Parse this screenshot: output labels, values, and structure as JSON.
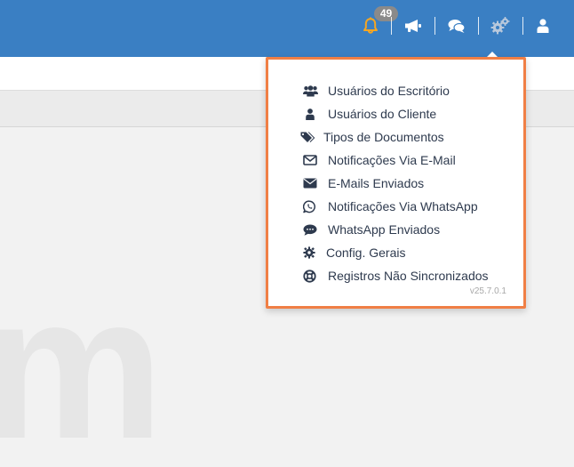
{
  "header": {
    "notifications_badge": "49",
    "icons": [
      "bell-icon",
      "megaphone-icon",
      "chat-icon",
      "gears-icon",
      "user-icon"
    ],
    "accent_color": "#3a7fc3",
    "bell_color": "#f5a623"
  },
  "dropdown": {
    "border_color": "#f07f45",
    "items": [
      {
        "label": "Usuários do Escritório",
        "icon": "users-icon"
      },
      {
        "label": "Usuários do Cliente",
        "icon": "user-icon"
      },
      {
        "label": "Tipos de Documentos",
        "icon": "tags-icon"
      },
      {
        "label": "Notificações Via E-Mail",
        "icon": "envelope-outline-icon"
      },
      {
        "label": "E-Mails Enviados",
        "icon": "envelope-icon"
      },
      {
        "label": "Notificações Via WhatsApp",
        "icon": "whatsapp-icon"
      },
      {
        "label": "WhatsApp Enviados",
        "icon": "speech-bubble-icon"
      },
      {
        "label": "Config. Gerais",
        "icon": "gear-icon"
      },
      {
        "label": "Registros Não Sincronizados",
        "icon": "lifebuoy-icon"
      }
    ],
    "version": "v25.7.0.1"
  },
  "background": {
    "watermark_letter": "m"
  }
}
